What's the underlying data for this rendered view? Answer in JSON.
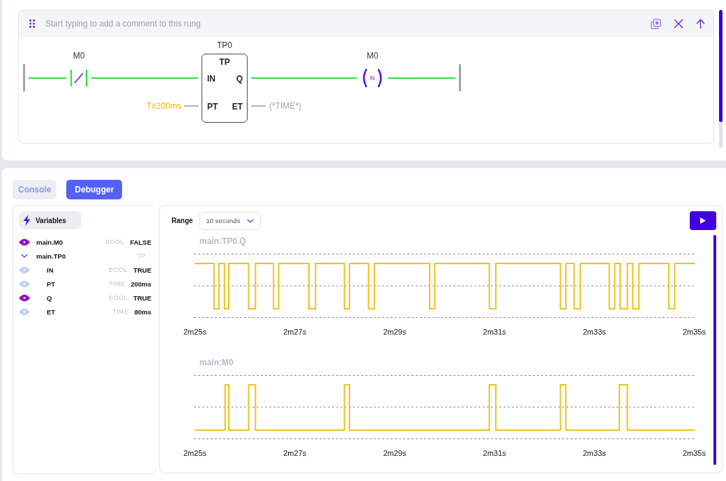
{
  "rung": {
    "comment_placeholder": "Start typing to add a comment to this rung",
    "elements": [
      {
        "kind": "contact",
        "variable": "M0",
        "negated": true
      },
      {
        "kind": "block",
        "instance": "TP0",
        "type": "TP",
        "inputs": [
          {
            "pin": "IN"
          },
          {
            "pin": "PT",
            "value": "T#200ms"
          }
        ],
        "outputs": [
          {
            "pin": "Q"
          },
          {
            "pin": "ET",
            "value": "(*TIME*)"
          }
        ]
      },
      {
        "kind": "coil",
        "variable": "M0",
        "symbol": "N"
      }
    ]
  },
  "panel_tabs": [
    {
      "label": "Console",
      "selected": false
    },
    {
      "label": "Debugger",
      "selected": true
    }
  ],
  "variables": {
    "title": "Variables",
    "items": [
      {
        "name": "main.M0",
        "type": "BOOL",
        "value": "FALSE",
        "watched": true
      },
      {
        "name": "main.TP0",
        "type": "TP",
        "expanded": true,
        "children": [
          {
            "name": "IN",
            "type": "BOOL",
            "value": "TRUE",
            "watched": false
          },
          {
            "name": "PT",
            "type": "TIME",
            "value": "200ms",
            "watched": false
          },
          {
            "name": "Q",
            "type": "BOOL",
            "value": "TRUE",
            "watched": true
          },
          {
            "name": "ET",
            "type": "TIME",
            "value": "80ms",
            "watched": false
          }
        ]
      }
    ]
  },
  "debugger": {
    "range_label": "Range",
    "range": {
      "value": "10 seconds"
    },
    "traces": [
      {
        "title": "main:TP0.Q",
        "x_labels": [
          "2m25s",
          "2m27s",
          "2m29s",
          "2m31s",
          "2m33s",
          "2m35s"
        ]
      },
      {
        "title": "main:M0",
        "x_labels": [
          "2m25s",
          "2m27s",
          "2m29s",
          "2m31s",
          "2m33s",
          "2m35s"
        ]
      }
    ]
  }
}
